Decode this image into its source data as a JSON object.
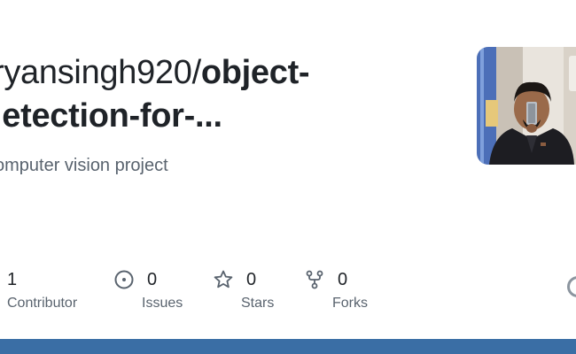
{
  "repo": {
    "owner_segment": "ryansingh920/",
    "name_line1": "object-",
    "name_line2": "letection-for-...",
    "description": "omputer vision project"
  },
  "stats": [
    {
      "icon": "people-icon",
      "value": "1",
      "label": "Contributor"
    },
    {
      "icon": "issue-circle-icon",
      "value": "0",
      "label": "Issues"
    },
    {
      "icon": "star-icon",
      "value": "0",
      "label": "Stars"
    },
    {
      "icon": "fork-icon",
      "value": "0",
      "label": "Forks"
    }
  ],
  "colors": {
    "text": "#1f2328",
    "muted": "#59636e",
    "bottom_bar": "#3a6ea5"
  }
}
